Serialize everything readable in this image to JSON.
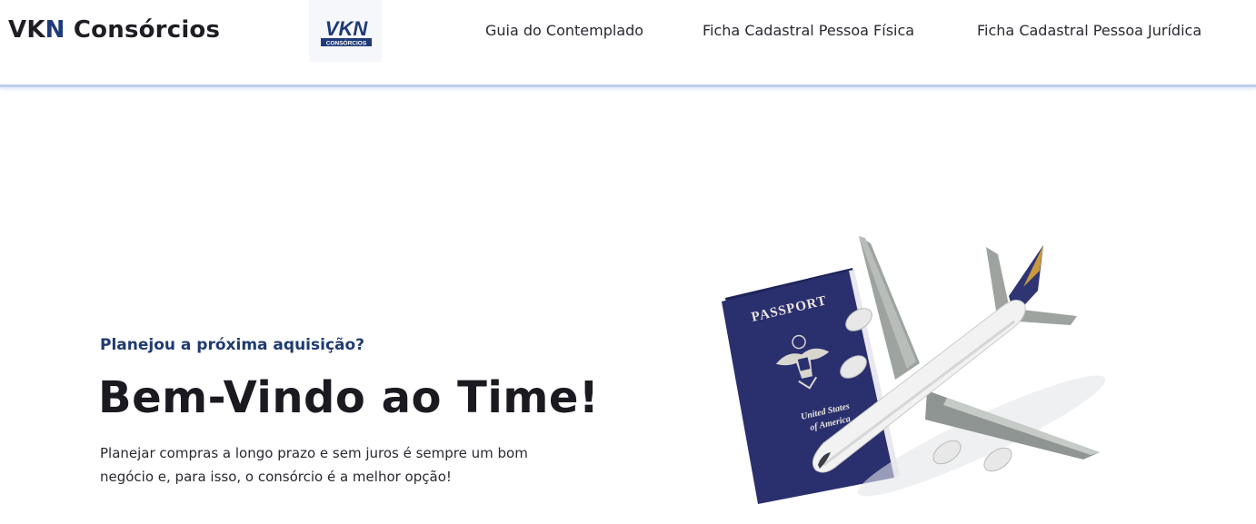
{
  "header": {
    "brand_prefix": "VK",
    "brand_highlight": "N",
    "brand_suffix": " Consórcios",
    "logo": {
      "letters": "VKN",
      "subtext": "CONSÓRCIOS"
    },
    "nav": [
      "Guia do Contemplado",
      "Ficha Cadastral Pessoa Física",
      "Ficha Cadastral Pessoa Jurídica"
    ]
  },
  "hero": {
    "eyebrow": "Planejou a próxima aquisição?",
    "title": "Bem-Vindo ao Time!",
    "text_line1": "Planejar compras a longo prazo e sem juros é sempre um bom",
    "text_line2": "negócio e, para isso, o consórcio é a melhor opção!",
    "image": {
      "passport_label": "PASSPORT",
      "country_line1": "United States",
      "country_line2": "of America"
    }
  },
  "colors": {
    "brand_blue": "#1f3a7a",
    "passport_navy": "#2a2f6e",
    "header_border": "#b9cdef"
  }
}
